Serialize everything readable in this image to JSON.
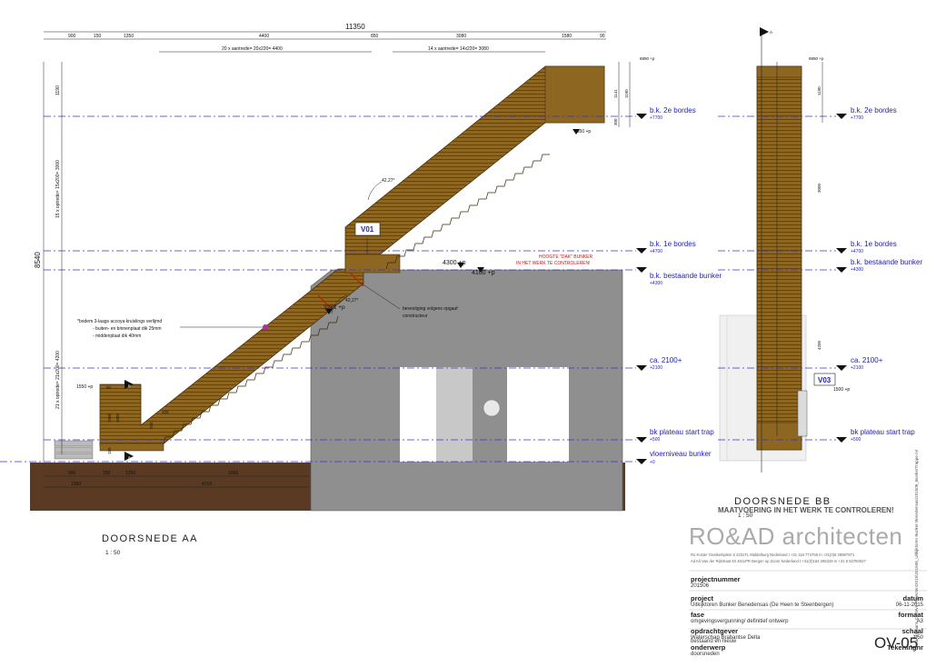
{
  "section_aa": {
    "title": "DOORSNEDE AA",
    "scale": "1 : 50",
    "top_dims": [
      "900",
      "150",
      "1350",
      "4400",
      "850",
      "3080",
      "1580",
      "90"
    ],
    "overall_dim": "11350",
    "tread_left": "20 x aantrede= 20x220= 4400",
    "tread_right": "14 x aantrede= 14x220= 3080",
    "vertical_total": "8540",
    "left_vertical_dims": [
      "1190",
      "15 x optrede= 15x200= 3000",
      "21 x optrede= 21x200= 4200"
    ],
    "right_dims": [
      "8890 +p",
      "1141",
      "1190",
      "300"
    ],
    "level_7550": "7550 +p",
    "angle_top": "42,27°",
    "angle_mid": "42,27°",
    "tag_v01": "V01",
    "level_4300": "4300 +p",
    "level_4100": "4100 +p",
    "level_3281": "3281 +p",
    "dak_note_1": "HOOGTE \"DAK\" BUNKER",
    "dak_note_2": "IN HET WERK TE CONTROLEREN!",
    "bevestiging_1": "bevestiging volgens opgaaf",
    "bevestiging_2": "constructeur",
    "note_board_1": "*bodem 3-laags accoya kruislings verlijmd",
    "note_board_2": "- buiten- en binnenplaat dik 25mm",
    "note_board_3": "- middenplaat dik 40mm",
    "level_1550": "1550 +p",
    "small_dims": [
      "50",
      "1050",
      "1000",
      "150",
      "200",
      "220"
    ],
    "section_marker": "B",
    "bottom_dims_1": [
      "900",
      "150",
      "1250",
      "3366"
    ],
    "bottom_dims_2": [
      "1050",
      "4716"
    ],
    "levels": [
      {
        "name": "b.k. 2e bordes",
        "value": "+7700"
      },
      {
        "name": "b.k. 1e bordes",
        "value": "+4700"
      },
      {
        "name": "b.k. bestaande bunker",
        "value": "+4300"
      },
      {
        "name": "ca. 2100+",
        "value": "+2100"
      },
      {
        "name": "bk plateau start trap",
        "value": "+500"
      },
      {
        "name": "vloerniveau bunker",
        "value": "+0"
      }
    ]
  },
  "section_bb": {
    "title": "DOORSNEDE BB",
    "scale": "1 : 50",
    "marker": "A",
    "dims": [
      "8890 +p",
      "1190",
      "3000",
      "4200"
    ],
    "tag_v03": "V03",
    "level_1500": "1500 +p",
    "warning": "MAATVOERING IN HET WERK TE CONTROLEREN!",
    "levels": [
      {
        "name": "b.k. 2e bordes",
        "value": "+7700"
      },
      {
        "name": "b.k. 1e bordes",
        "value": "+4700"
      },
      {
        "name": "b.k. bestaande bunker",
        "value": "+4300"
      },
      {
        "name": "ca. 2100+",
        "value": "+2100"
      },
      {
        "name": "bk plateau start trap",
        "value": "+500"
      }
    ]
  },
  "titleblock": {
    "logo": "RO&AD architecten",
    "address_1": "Ro Koster  Oostkerkplein 5  4331TL  Middelburg  Nederland  t +31 118 774755  m +31(0)6 28987971",
    "address_2": "Ad Kil  Van der Rijtstraat 40  4611PR  Bergen op Zoom  Nederland  t +31(0)164 266329  m +31 6 53750027",
    "projectnummer_label": "projectnummer",
    "projectnummer": "201506",
    "project_label": "project",
    "project": "Uitkijktoren Bunker Benedensas (De Heen te Steenbergen)",
    "datum_label": "datum",
    "datum": "06-11-2015",
    "fase_label": "fase",
    "fase": "omgevingsvergunning/ definitief ontwerp",
    "formaat_label": "formaat",
    "formaat": "A3",
    "opdrachtgever_label": "opdrachtgever",
    "opdrachtgever": "Waterschap Brabantse Delta",
    "schaal_label": "schaal",
    "schaal": "1:50",
    "onderwerp_label": "onderwerp",
    "onderwerp_1": "doorsneden",
    "onderwerp_2": "bestaand en nieuw",
    "tekeningnr_label": "Tekeningnr",
    "tekeningnr": "OV-05",
    "file_path": "bestandsnaam:  C:\\Revit Projecten\\2015\\201506_Uitkijktoren Bunker Benedensas\\201506_BunkerTrappe.rvt"
  },
  "colors": {
    "wood": "#8a6420",
    "wood_dark": "#5a3f10",
    "concrete": "#8f8f8f",
    "ground": "#5a3a22",
    "level_line": "#3333cc",
    "level_text": "#2222bb",
    "red_note": "#cc1111"
  }
}
